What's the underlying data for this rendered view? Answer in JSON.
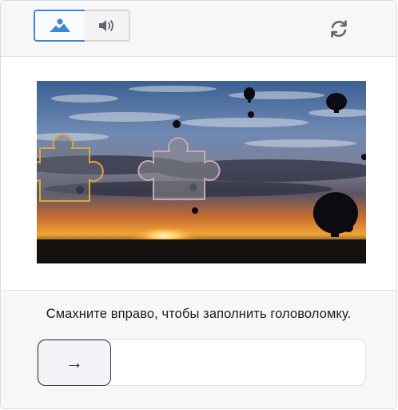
{
  "header": {
    "modes": [
      {
        "name": "image",
        "icon": "image-mountain-icon",
        "active": true
      },
      {
        "name": "audio",
        "icon": "speaker-icon",
        "active": false
      }
    ],
    "refresh_icon": "refresh-icon"
  },
  "puzzle": {
    "piece_outline_color": "#e0a53a",
    "target_outline_color": "#c8a7b5"
  },
  "footer": {
    "instruction": "Смахните вправо, чтобы заполнить головоломку.",
    "slider_icon": "arrow-right-icon",
    "slider_arrow": "→"
  },
  "colors": {
    "accent": "#3f88d6",
    "handle_border": "#2b3440"
  }
}
